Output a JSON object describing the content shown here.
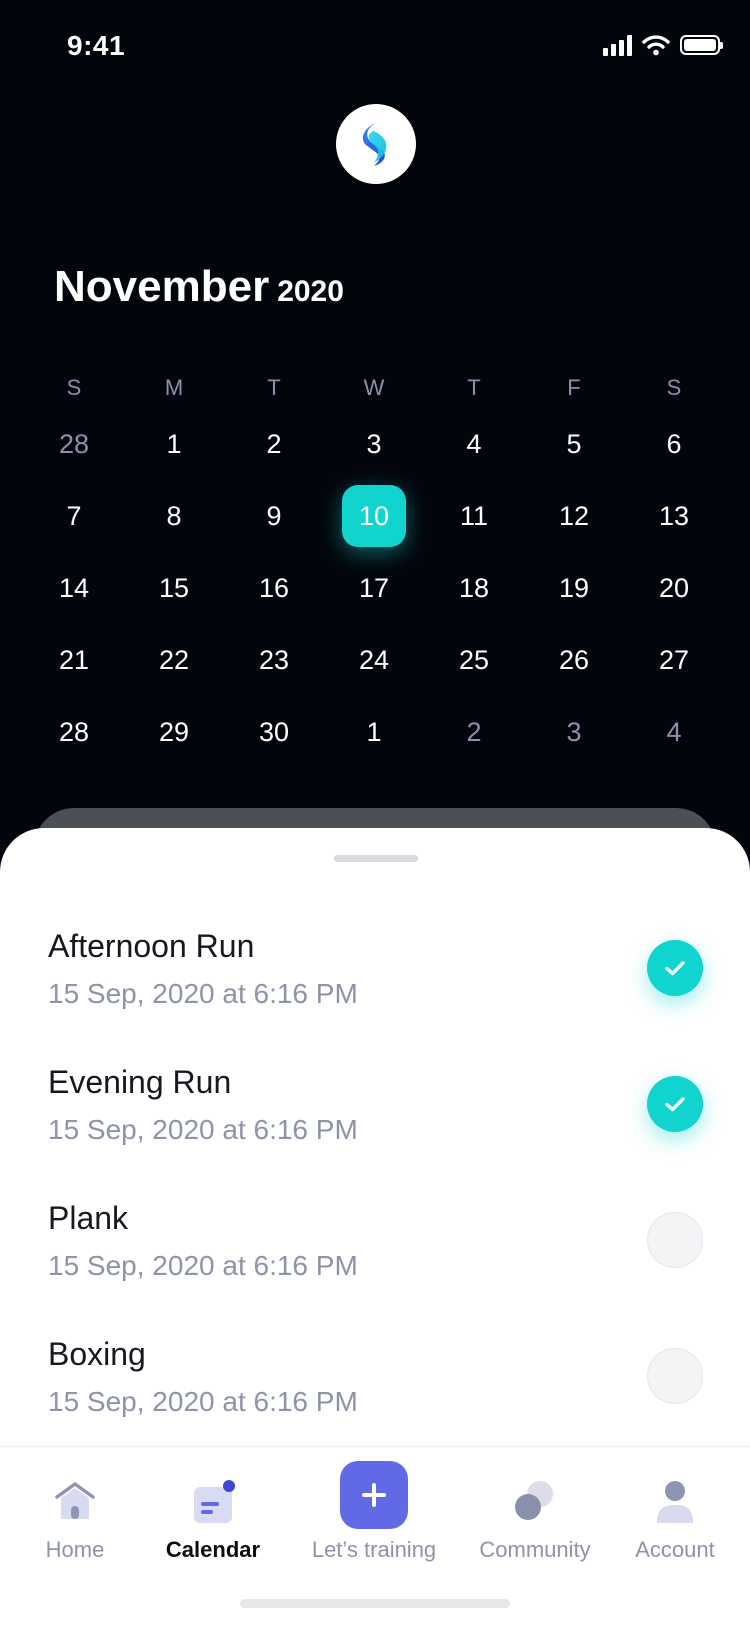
{
  "status_bar": {
    "time": "9:41"
  },
  "calendar": {
    "month": "November",
    "year": "2020",
    "weekdays": [
      "S",
      "M",
      "T",
      "W",
      "T",
      "F",
      "S"
    ],
    "weeks": [
      [
        "28",
        "1",
        "2",
        "3",
        "4",
        "5",
        "6"
      ],
      [
        "7",
        "8",
        "9",
        "10",
        "11",
        "12",
        "13"
      ],
      [
        "14",
        "15",
        "16",
        "17",
        "18",
        "19",
        "20"
      ],
      [
        "21",
        "22",
        "23",
        "24",
        "25",
        "26",
        "27"
      ],
      [
        "28",
        "29",
        "30",
        "1",
        "2",
        "3",
        "4"
      ]
    ],
    "selected_day": "10",
    "accent_color": "#12d4cf"
  },
  "activities": [
    {
      "title": "Afternoon Run",
      "time": "15 Sep, 2020 at 6:16 PM",
      "completed": true
    },
    {
      "title": "Evening Run",
      "time": "15 Sep, 2020 at 6:16 PM",
      "completed": true
    },
    {
      "title": "Plank",
      "time": "15 Sep, 2020 at 6:16 PM",
      "completed": false
    },
    {
      "title": "Boxing",
      "time": "15 Sep, 2020 at 6:16 PM",
      "completed": false
    }
  ],
  "tabbar": {
    "home": "Home",
    "calendar": "Calendar",
    "training": "Let’s training",
    "community": "Community",
    "account": "Account",
    "active": "calendar",
    "primary_color": "#6169e4"
  }
}
